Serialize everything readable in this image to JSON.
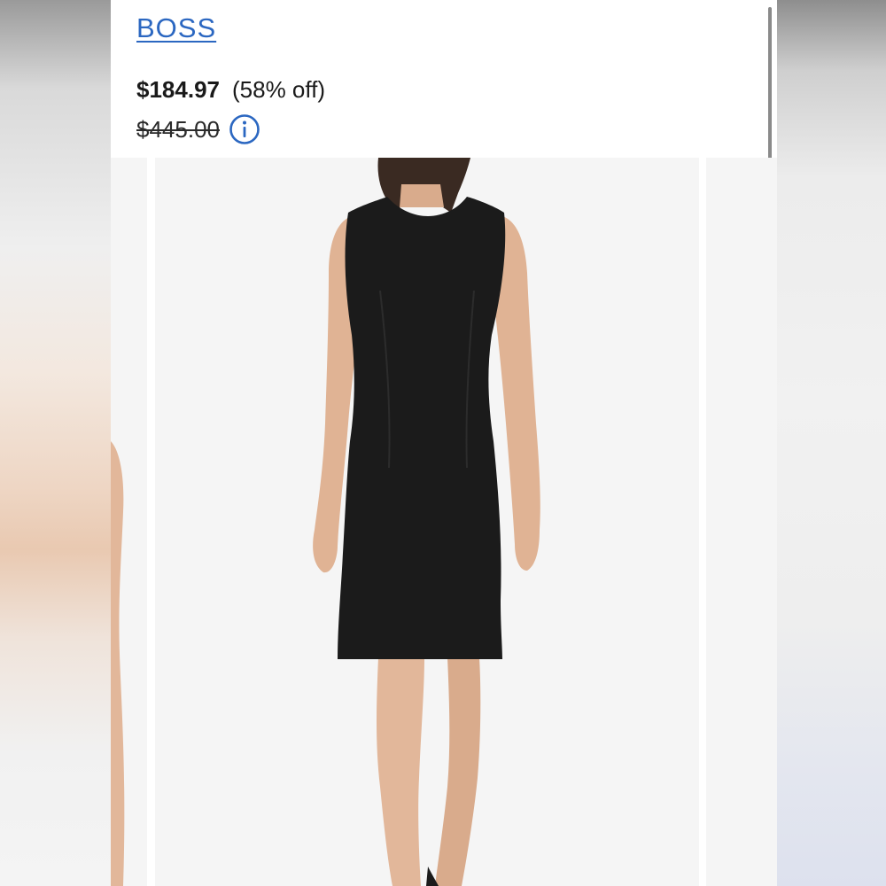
{
  "product": {
    "brand": "BOSS",
    "sale_price": "$184.97",
    "discount": "(58% off)",
    "original_price": "$445.00"
  },
  "icons": {
    "info": "info-circle-icon"
  },
  "colors": {
    "brand_link": "#2b67c1",
    "text": "#1a1a1a",
    "photo_background": "#f5f5f5",
    "dress": "#1b1b1b",
    "skin": "#e2b79a"
  },
  "carousel": {
    "images": [
      "partial-previous-image",
      "black-sleeveless-sheath-dress-front",
      "partial-next-image"
    ],
    "active_index": 1
  }
}
